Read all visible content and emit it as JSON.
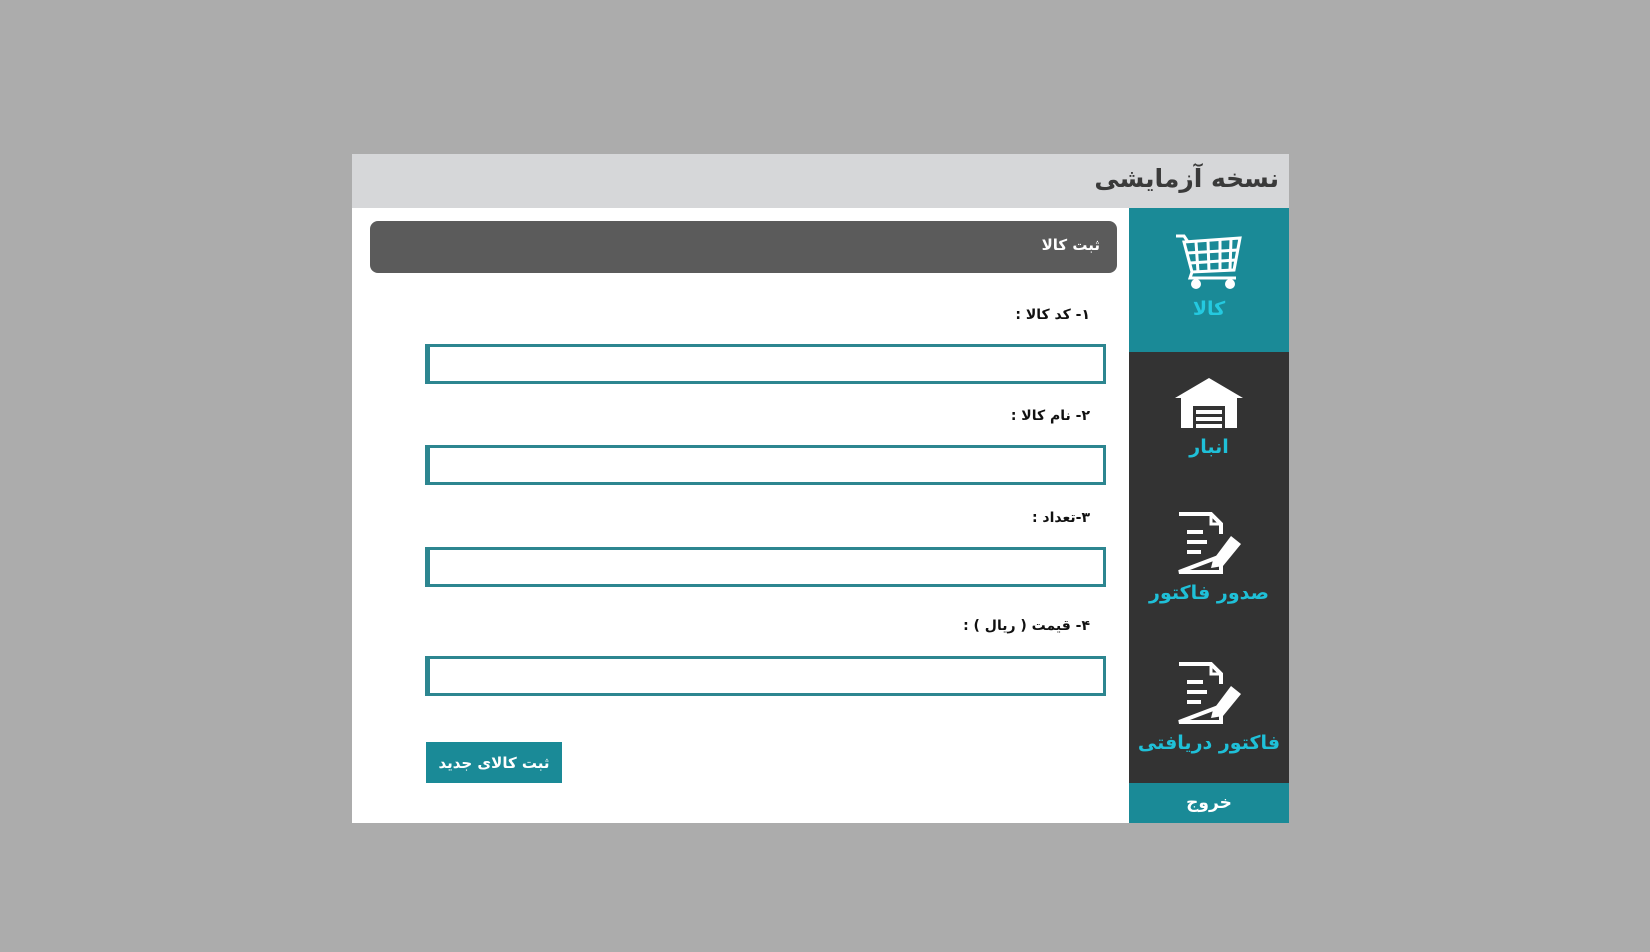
{
  "window": {
    "title": "نسخه آزمایشی"
  },
  "sidebar": {
    "items": [
      {
        "label": "کالا",
        "icon": "cart-icon",
        "active": true
      },
      {
        "label": "انبار",
        "icon": "warehouse-icon",
        "active": false
      },
      {
        "label": "صدور فاکتور",
        "icon": "invoice-edit-icon",
        "active": false
      },
      {
        "label": "فاکتور دریافتی",
        "icon": "invoice-edit-icon",
        "active": false
      }
    ],
    "logout_label": "خروج"
  },
  "main": {
    "section_title": "ثبت کالا",
    "fields": [
      {
        "label": "۱- کد کالا :",
        "value": ""
      },
      {
        "label": "۲- نام کالا :",
        "value": ""
      },
      {
        "label": "۳-تعداد :",
        "value": ""
      },
      {
        "label": "۴- قیمت ( ریال ) :",
        "value": ""
      }
    ],
    "submit_label": "ثبت کالای جدید"
  },
  "colors": {
    "background": "#acacac",
    "titlebar": "#d6d7d9",
    "sidebar": "#333333",
    "accent": "#1a8a97",
    "nav_label": "#1fc0d8",
    "section_header": "#5b5b5b",
    "input_border": "#2d8690"
  }
}
